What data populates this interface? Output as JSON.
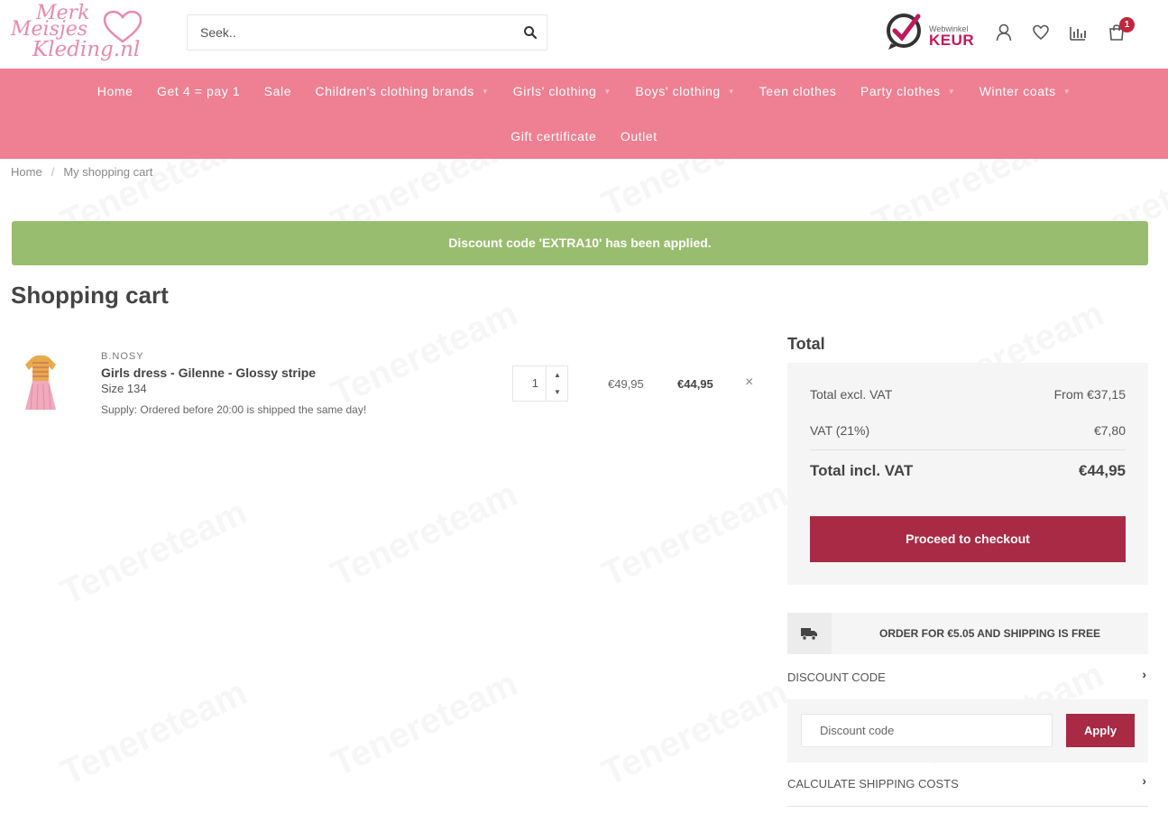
{
  "header": {
    "logo_lines": [
      "Merk",
      "Meisjes",
      "Kleding.nl"
    ],
    "search_placeholder": "Seek..",
    "keur_small": "Webwinkel",
    "keur_big": "KEUR",
    "cart_count": "1",
    "icons": [
      "search-icon",
      "account-icon",
      "heart-icon",
      "compare-icon",
      "cart-icon"
    ]
  },
  "nav": {
    "row1": [
      {
        "label": "Home",
        "dropdown": false
      },
      {
        "label": "Get 4 = pay 1",
        "dropdown": false
      },
      {
        "label": "Sale",
        "dropdown": false
      },
      {
        "label": "Children's clothing brands",
        "dropdown": true
      },
      {
        "label": "Girls' clothing",
        "dropdown": true
      },
      {
        "label": "Boys' clothing",
        "dropdown": true
      },
      {
        "label": "Teen clothes",
        "dropdown": false
      },
      {
        "label": "Party clothes",
        "dropdown": true
      },
      {
        "label": "Winter coats",
        "dropdown": true
      }
    ],
    "row2": [
      {
        "label": "Gift certificate",
        "dropdown": false
      },
      {
        "label": "Outlet",
        "dropdown": false
      }
    ]
  },
  "breadcrumb": {
    "home": "Home",
    "sep": "/",
    "current": "My shopping cart"
  },
  "alert": "Discount code 'EXTRA10' has been applied.",
  "page_title": "Shopping cart",
  "cart_item": {
    "brand": "B.NOSY",
    "name": "Girls dress - Gilenne - Glossy stripe",
    "size": "Size 134",
    "supply": "Supply: Ordered before 20:00 is shipped the same day!",
    "quantity": "1",
    "price_original": "€49,95",
    "price_total": "€44,95",
    "remove": "×"
  },
  "totals": {
    "title": "Total",
    "excl_label": "Total excl. VAT",
    "excl_value": "From €37,15",
    "vat_label": "VAT (21%)",
    "vat_value": "€7,80",
    "incl_label": "Total incl. VAT",
    "incl_value": "€44,95",
    "checkout_label": "Proceed to checkout"
  },
  "shipping_notice": "ORDER FOR €5.05 AND SHIPPING IS FREE",
  "discount": {
    "heading": "DISCOUNT CODE",
    "placeholder": "Discount code",
    "apply_label": "Apply"
  },
  "shipping_costs_heading": "CALCULATE SHIPPING COSTS",
  "watermark": "Tenereteam",
  "colors": {
    "nav_bg": "#ef7f92",
    "alert_bg": "#99bd6e",
    "button_bg": "#a82a44",
    "logo_pink": "#e98aa9"
  }
}
